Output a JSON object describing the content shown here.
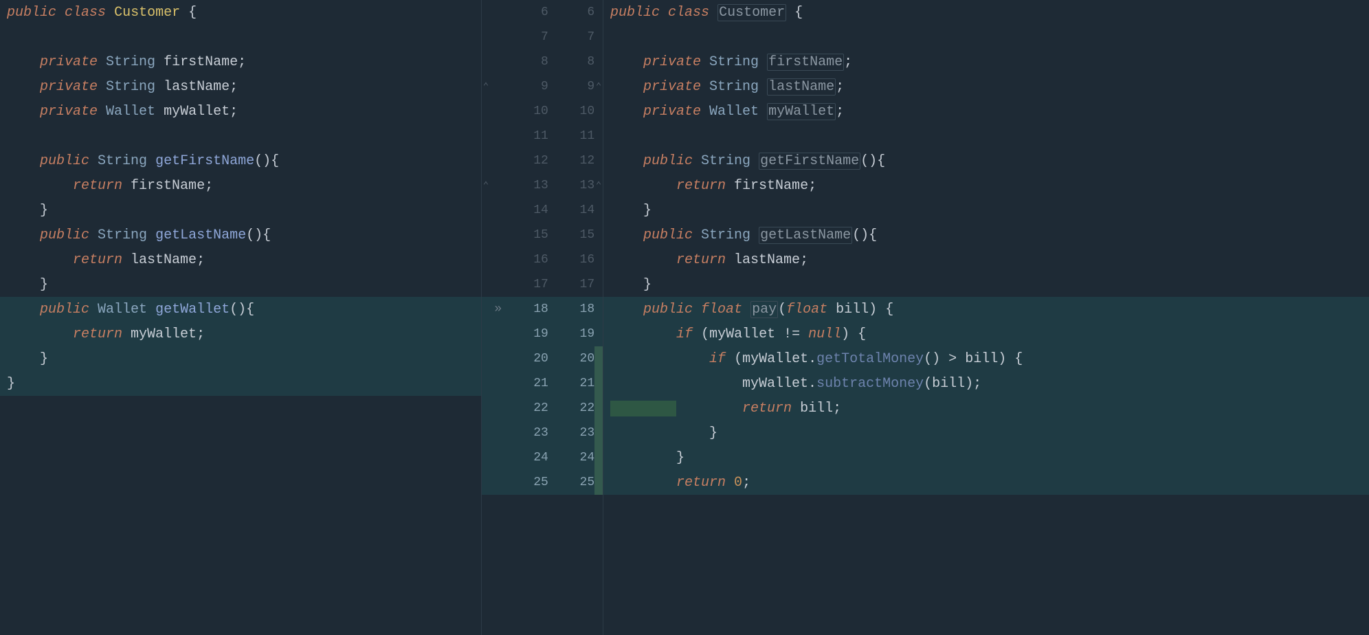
{
  "gutter": {
    "marker_row": 13,
    "marker_glyph": "»",
    "fold_left_rows": [
      4,
      8
    ],
    "fold_right_rows": [
      4,
      8
    ],
    "rows": [
      {
        "l": "6",
        "r": "6"
      },
      {
        "l": "7",
        "r": "7"
      },
      {
        "l": "8",
        "r": "8"
      },
      {
        "l": "9",
        "r": "9"
      },
      {
        "l": "10",
        "r": "10"
      },
      {
        "l": "11",
        "r": "11"
      },
      {
        "l": "12",
        "r": "12"
      },
      {
        "l": "13",
        "r": "13"
      },
      {
        "l": "14",
        "r": "14"
      },
      {
        "l": "15",
        "r": "15"
      },
      {
        "l": "16",
        "r": "16"
      },
      {
        "l": "17",
        "r": "17"
      },
      {
        "l": "18",
        "r": "18",
        "changed": true
      },
      {
        "l": "19",
        "r": "19",
        "changed": true
      },
      {
        "l": "20",
        "r": "20",
        "changed": true,
        "added": true
      },
      {
        "l": "21",
        "r": "21",
        "changed": true,
        "added": true
      },
      {
        "l": "22",
        "r": "22",
        "changed": true,
        "added": true
      },
      {
        "l": "23",
        "r": "23",
        "changed": true,
        "added": true
      },
      {
        "l": "24",
        "r": "24",
        "changed": true,
        "added": true
      },
      {
        "l": "25",
        "r": "25",
        "changed": true,
        "added": true
      }
    ]
  },
  "left": {
    "lines": [
      [
        [
          "kw",
          "public"
        ],
        [
          "sp",
          " "
        ],
        [
          "kw",
          "class"
        ],
        [
          "sp",
          " "
        ],
        [
          "cls",
          "Customer"
        ],
        [
          "sp",
          " "
        ],
        [
          "braces",
          "{"
        ]
      ],
      [
        [
          "sp",
          ""
        ]
      ],
      [
        [
          "sp",
          "    "
        ],
        [
          "kw",
          "private"
        ],
        [
          "sp",
          " "
        ],
        [
          "type",
          "String"
        ],
        [
          "sp",
          " "
        ],
        [
          "id",
          "firstName"
        ],
        [
          "punct",
          ";"
        ]
      ],
      [
        [
          "sp",
          "    "
        ],
        [
          "kw",
          "private"
        ],
        [
          "sp",
          " "
        ],
        [
          "type",
          "String"
        ],
        [
          "sp",
          " "
        ],
        [
          "id",
          "lastName"
        ],
        [
          "punct",
          ";"
        ]
      ],
      [
        [
          "sp",
          "    "
        ],
        [
          "kw",
          "private"
        ],
        [
          "sp",
          " "
        ],
        [
          "type",
          "Wallet"
        ],
        [
          "sp",
          " "
        ],
        [
          "id",
          "myWallet"
        ],
        [
          "punct",
          ";"
        ]
      ],
      [
        [
          "sp",
          ""
        ]
      ],
      [
        [
          "sp",
          "    "
        ],
        [
          "kw",
          "public"
        ],
        [
          "sp",
          " "
        ],
        [
          "type",
          "String"
        ],
        [
          "sp",
          " "
        ],
        [
          "fn",
          "getFirstName"
        ],
        [
          "punct",
          "(){"
        ]
      ],
      [
        [
          "sp",
          "        "
        ],
        [
          "kw",
          "return"
        ],
        [
          "sp",
          " "
        ],
        [
          "id",
          "firstName"
        ],
        [
          "punct",
          ";"
        ]
      ],
      [
        [
          "sp",
          "    "
        ],
        [
          "braces",
          "}"
        ]
      ],
      [
        [
          "sp",
          "    "
        ],
        [
          "kw",
          "public"
        ],
        [
          "sp",
          " "
        ],
        [
          "type",
          "String"
        ],
        [
          "sp",
          " "
        ],
        [
          "fn",
          "getLastName"
        ],
        [
          "punct",
          "(){"
        ]
      ],
      [
        [
          "sp",
          "        "
        ],
        [
          "kw",
          "return"
        ],
        [
          "sp",
          " "
        ],
        [
          "id",
          "lastName"
        ],
        [
          "punct",
          ";"
        ]
      ],
      [
        [
          "sp",
          "    "
        ],
        [
          "braces",
          "}"
        ]
      ],
      [
        [
          "sp",
          "    "
        ],
        [
          "kw",
          "public"
        ],
        [
          "sp",
          " "
        ],
        [
          "type",
          "Wallet"
        ],
        [
          "sp",
          " "
        ],
        [
          "fn",
          "getWallet"
        ],
        [
          "punct",
          "(){"
        ]
      ],
      [
        [
          "sp",
          "        "
        ],
        [
          "kw",
          "return"
        ],
        [
          "sp",
          " "
        ],
        [
          "id",
          "myWallet"
        ],
        [
          "punct",
          ";"
        ]
      ],
      [
        [
          "sp",
          "    "
        ],
        [
          "braces",
          "}"
        ]
      ],
      [
        [
          "braces",
          "}"
        ]
      ],
      [
        [
          "sp",
          ""
        ]
      ],
      [
        [
          "sp",
          ""
        ]
      ],
      [
        [
          "sp",
          ""
        ]
      ],
      [
        [
          "sp",
          ""
        ]
      ]
    ],
    "changed_rows": [
      13,
      14,
      15,
      16
    ]
  },
  "right": {
    "lines": [
      [
        [
          "kw",
          "public"
        ],
        [
          "sp",
          " "
        ],
        [
          "kw",
          "class"
        ],
        [
          "sp",
          " "
        ],
        [
          "boxed",
          "Customer"
        ],
        [
          "sp",
          " "
        ],
        [
          "braces",
          "{"
        ]
      ],
      [
        [
          "sp",
          ""
        ]
      ],
      [
        [
          "sp",
          "    "
        ],
        [
          "kw",
          "private"
        ],
        [
          "sp",
          " "
        ],
        [
          "type",
          "String"
        ],
        [
          "sp",
          " "
        ],
        [
          "boxed",
          "firstName"
        ],
        [
          "punct",
          ";"
        ]
      ],
      [
        [
          "sp",
          "    "
        ],
        [
          "kw",
          "private"
        ],
        [
          "sp",
          " "
        ],
        [
          "type",
          "String"
        ],
        [
          "sp",
          " "
        ],
        [
          "boxed",
          "lastName"
        ],
        [
          "punct",
          ";"
        ]
      ],
      [
        [
          "sp",
          "    "
        ],
        [
          "kw",
          "private"
        ],
        [
          "sp",
          " "
        ],
        [
          "type",
          "Wallet"
        ],
        [
          "sp",
          " "
        ],
        [
          "boxed",
          "myWallet"
        ],
        [
          "punct",
          ";"
        ]
      ],
      [
        [
          "sp",
          ""
        ]
      ],
      [
        [
          "sp",
          "    "
        ],
        [
          "kw",
          "public"
        ],
        [
          "sp",
          " "
        ],
        [
          "type",
          "String"
        ],
        [
          "sp",
          " "
        ],
        [
          "boxed",
          "getFirstName"
        ],
        [
          "punct",
          "(){"
        ]
      ],
      [
        [
          "sp",
          "        "
        ],
        [
          "kw",
          "return"
        ],
        [
          "sp",
          " "
        ],
        [
          "id",
          "firstName"
        ],
        [
          "punct",
          ";"
        ]
      ],
      [
        [
          "sp",
          "    "
        ],
        [
          "braces",
          "}"
        ]
      ],
      [
        [
          "sp",
          "    "
        ],
        [
          "kw",
          "public"
        ],
        [
          "sp",
          " "
        ],
        [
          "type",
          "String"
        ],
        [
          "sp",
          " "
        ],
        [
          "boxed",
          "getLastName"
        ],
        [
          "punct",
          "(){"
        ]
      ],
      [
        [
          "sp",
          "        "
        ],
        [
          "kw",
          "return"
        ],
        [
          "sp",
          " "
        ],
        [
          "id",
          "lastName"
        ],
        [
          "punct",
          ";"
        ]
      ],
      [
        [
          "sp",
          "    "
        ],
        [
          "braces",
          "}"
        ]
      ],
      [
        [
          "sp",
          "    "
        ],
        [
          "kw",
          "public"
        ],
        [
          "sp",
          " "
        ],
        [
          "kw",
          "float"
        ],
        [
          "sp",
          " "
        ],
        [
          "boxed",
          "pay"
        ],
        [
          "punct",
          "("
        ],
        [
          "kw",
          "float"
        ],
        [
          "sp",
          " "
        ],
        [
          "id",
          "bill"
        ],
        [
          "punct",
          ")"
        ],
        [
          "sp",
          " "
        ],
        [
          "braces",
          "{"
        ]
      ],
      [
        [
          "sp",
          "        "
        ],
        [
          "kw",
          "if"
        ],
        [
          "sp",
          " "
        ],
        [
          "punct",
          "("
        ],
        [
          "id",
          "myWallet"
        ],
        [
          "sp",
          " "
        ],
        [
          "op",
          "!="
        ],
        [
          "sp",
          " "
        ],
        [
          "kw",
          "null"
        ],
        [
          "punct",
          ")"
        ],
        [
          "sp",
          " "
        ],
        [
          "braces",
          "{"
        ]
      ],
      [
        [
          "sp",
          "            "
        ],
        [
          "kw",
          "if"
        ],
        [
          "sp",
          " "
        ],
        [
          "punct",
          "("
        ],
        [
          "id",
          "myWallet"
        ],
        [
          "punct",
          "."
        ],
        [
          "fn-dim",
          "getTotalMoney"
        ],
        [
          "punct",
          "()"
        ],
        [
          "sp",
          " "
        ],
        [
          "op",
          ">"
        ],
        [
          "sp",
          " "
        ],
        [
          "id",
          "bill"
        ],
        [
          "punct",
          ")"
        ],
        [
          "sp",
          " "
        ],
        [
          "braces",
          "{"
        ]
      ],
      [
        [
          "sp",
          "                "
        ],
        [
          "id",
          "myWallet"
        ],
        [
          "punct",
          "."
        ],
        [
          "fn-dim",
          "subtractMoney"
        ],
        [
          "punct",
          "("
        ],
        [
          "id",
          "bill"
        ],
        [
          "punct",
          ");"
        ]
      ],
      [
        [
          "added",
          "        "
        ],
        [
          "sp",
          "        "
        ],
        [
          "kw",
          "return"
        ],
        [
          "sp",
          " "
        ],
        [
          "id",
          "bill"
        ],
        [
          "punct",
          ";"
        ]
      ],
      [
        [
          "sp",
          "            "
        ],
        [
          "braces",
          "}"
        ]
      ],
      [
        [
          "sp",
          "        "
        ],
        [
          "braces",
          "}"
        ]
      ],
      [
        [
          "sp",
          "        "
        ],
        [
          "kw",
          "return"
        ],
        [
          "sp",
          " "
        ],
        [
          "num",
          "0"
        ],
        [
          "punct",
          ";"
        ]
      ]
    ],
    "changed_rows": [
      13,
      14,
      15,
      16,
      17,
      18,
      19,
      20
    ]
  }
}
